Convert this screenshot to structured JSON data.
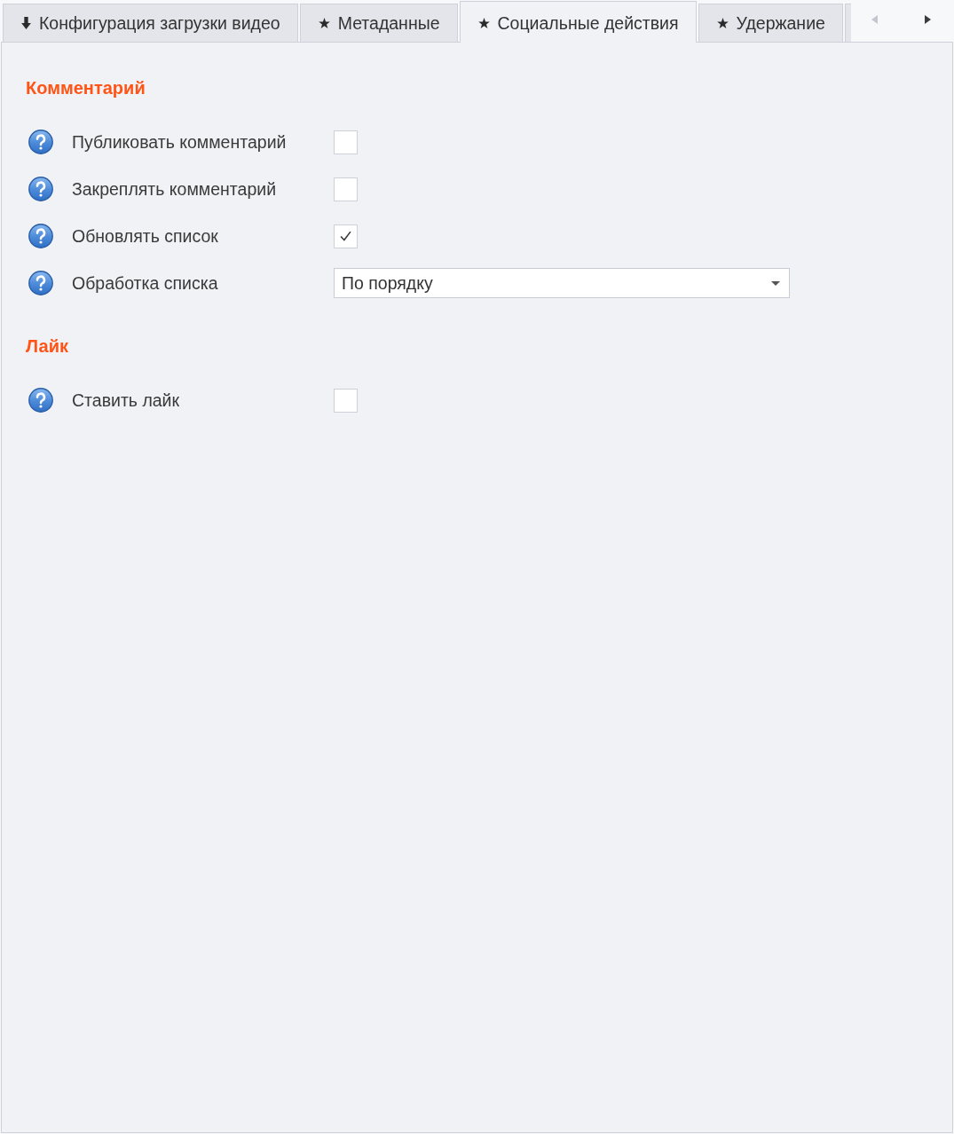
{
  "tabs": [
    {
      "kind": "arrow",
      "label": "Конфигурация загрузки видео",
      "selected": false
    },
    {
      "kind": "star",
      "label": "Метаданные",
      "selected": false
    },
    {
      "kind": "star",
      "label": "Социальные действия",
      "selected": true
    },
    {
      "kind": "star",
      "label": "Удержание",
      "selected": false
    }
  ],
  "tab_scroll_buttons": [
    {
      "kind": "left",
      "disabled": true
    },
    {
      "kind": "right",
      "disabled": false
    }
  ],
  "sections": [
    {
      "title": "Комментарий",
      "rows": [
        {
          "kind": "checkbox",
          "label": "Публиковать комментарий",
          "checked": false
        },
        {
          "kind": "checkbox",
          "label": "Закреплять комментарий",
          "checked": false
        },
        {
          "kind": "checkbox",
          "label": "Обновлять список",
          "checked": true
        },
        {
          "kind": "dropdown",
          "label": "Обработка списка",
          "value": "По порядку"
        }
      ]
    },
    {
      "title": "Лайк",
      "rows": [
        {
          "kind": "checkbox",
          "label": "Ставить лайк",
          "checked": false
        }
      ]
    }
  ]
}
